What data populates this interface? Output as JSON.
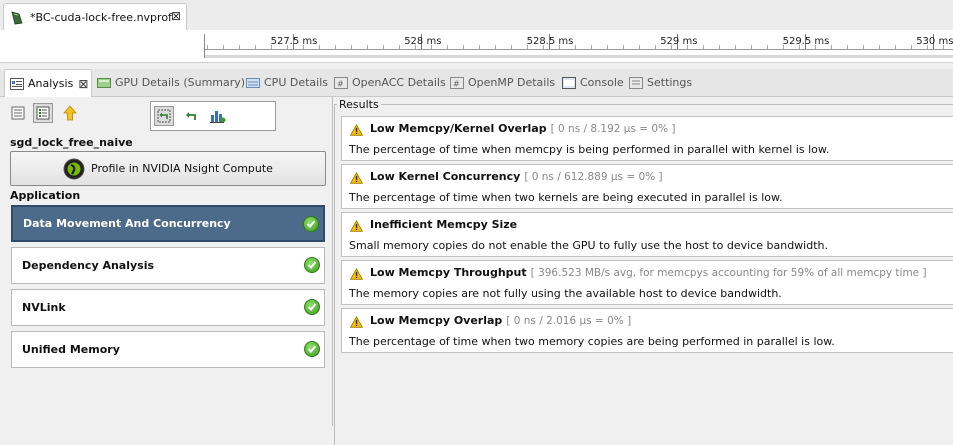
{
  "editor_tab": {
    "title": "*BC-cuda-lock-free.nvprof"
  },
  "timeline": {
    "ticks": [
      "527.5 ms",
      "528 ms",
      "528.5 ms",
      "529 ms",
      "529.5 ms",
      "530 ms"
    ]
  },
  "view_tabs": [
    {
      "label": "Analysis",
      "icon": "analysis-icon",
      "active": true
    },
    {
      "label": "GPU Details (Summary)",
      "icon": "gpu-details-icon"
    },
    {
      "label": "CPU Details",
      "icon": "cpu-details-icon"
    },
    {
      "label": "OpenACC Details",
      "icon": "openacc-icon"
    },
    {
      "label": "OpenMP Details",
      "icon": "openmp-icon"
    },
    {
      "label": "Console",
      "icon": "console-icon"
    },
    {
      "label": "Settings",
      "icon": "settings-icon"
    }
  ],
  "analysis": {
    "kernel_name": "sgd_lock_free_naive",
    "profile_button": "Profile in NVIDIA Nsight Compute",
    "section_title": "Application",
    "stages": [
      {
        "label": "Data Movement And Concurrency",
        "selected": true
      },
      {
        "label": "Dependency Analysis"
      },
      {
        "label": "NVLink"
      },
      {
        "label": "Unified Memory"
      }
    ]
  },
  "results": {
    "legend": "Results",
    "items": [
      {
        "title": "Low Memcpy/Kernel Overlap",
        "meta": "[ 0 ns / 8.192 μs = 0% ]",
        "desc": "The percentage of time when memcpy is being performed in parallel with kernel is low."
      },
      {
        "title": "Low Kernel Concurrency",
        "meta": "[ 0 ns / 612.889 μs = 0% ]",
        "desc": "The percentage of time when two kernels are being executed in parallel is low."
      },
      {
        "title": "Inefficient Memcpy Size",
        "meta": "",
        "desc": "Small memory copies do not enable the GPU to fully use the host to device bandwidth."
      },
      {
        "title": "Low Memcpy Throughput",
        "meta": "[ 396.523 MB/s avg, for memcpys accounting for 59% of all memcpy time ]",
        "desc": "The memory copies are not fully using the available host to device bandwidth."
      },
      {
        "title": "Low Memcpy Overlap",
        "meta": "[ 0 ns / 2.016 μs = 0% ]",
        "desc": "The percentage of time when two memory copies are being performed in parallel is low."
      }
    ]
  },
  "colors": {
    "selected_stage": "#4c6a8a",
    "check_green": "#3d9a21",
    "warning_yellow": "#f2c200"
  }
}
